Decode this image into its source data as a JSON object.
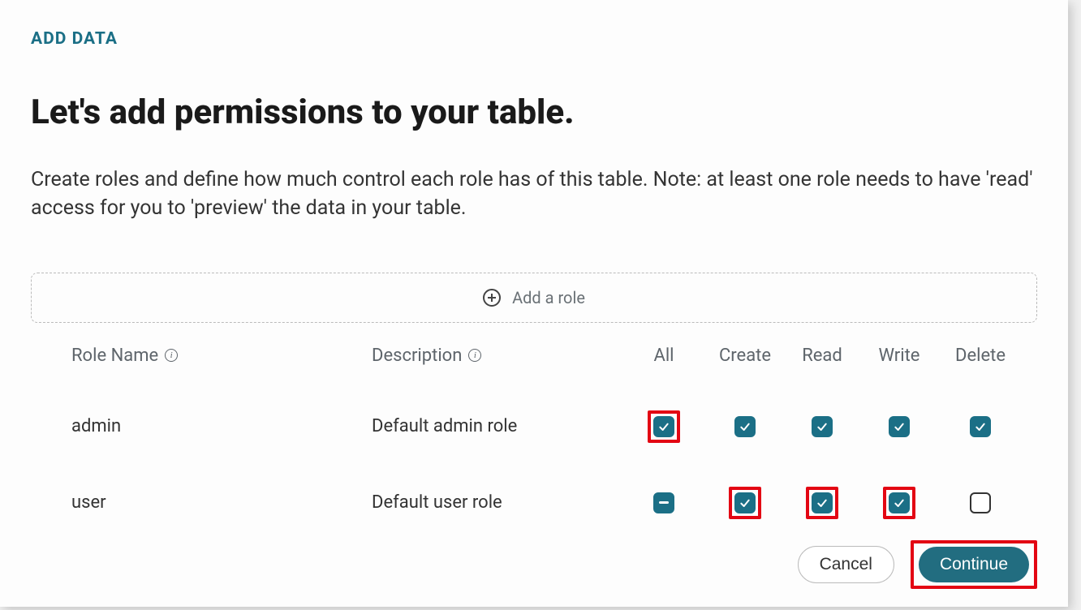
{
  "eyebrow": "ADD DATA",
  "headline": "Let's add permissions to your table.",
  "subhead": "Create roles and define how much control each role has of this table. Note: at least one role needs to have 'read' access for you to 'preview' the data in your table.",
  "addRole": {
    "label": "Add a role"
  },
  "columns": {
    "roleName": "Role Name",
    "description": "Description",
    "all": "All",
    "create": "Create",
    "read": "Read",
    "write": "Write",
    "delete": "Delete"
  },
  "rows": [
    {
      "name": "admin",
      "description": "Default admin role",
      "all": {
        "state": "checked",
        "highlight": true
      },
      "create": {
        "state": "checked",
        "highlight": false
      },
      "read": {
        "state": "checked",
        "highlight": false
      },
      "write": {
        "state": "checked",
        "highlight": false
      },
      "delete": {
        "state": "checked",
        "highlight": false
      }
    },
    {
      "name": "user",
      "description": "Default user role",
      "all": {
        "state": "indeterminate",
        "highlight": false
      },
      "create": {
        "state": "checked",
        "highlight": true
      },
      "read": {
        "state": "checked",
        "highlight": true
      },
      "write": {
        "state": "checked",
        "highlight": true
      },
      "delete": {
        "state": "unchecked",
        "highlight": false
      }
    }
  ],
  "actions": {
    "cancel": "Cancel",
    "continue": "Continue",
    "continueHighlighted": true
  },
  "colors": {
    "accent": "#1b6f86",
    "highlight": "#e30613"
  }
}
